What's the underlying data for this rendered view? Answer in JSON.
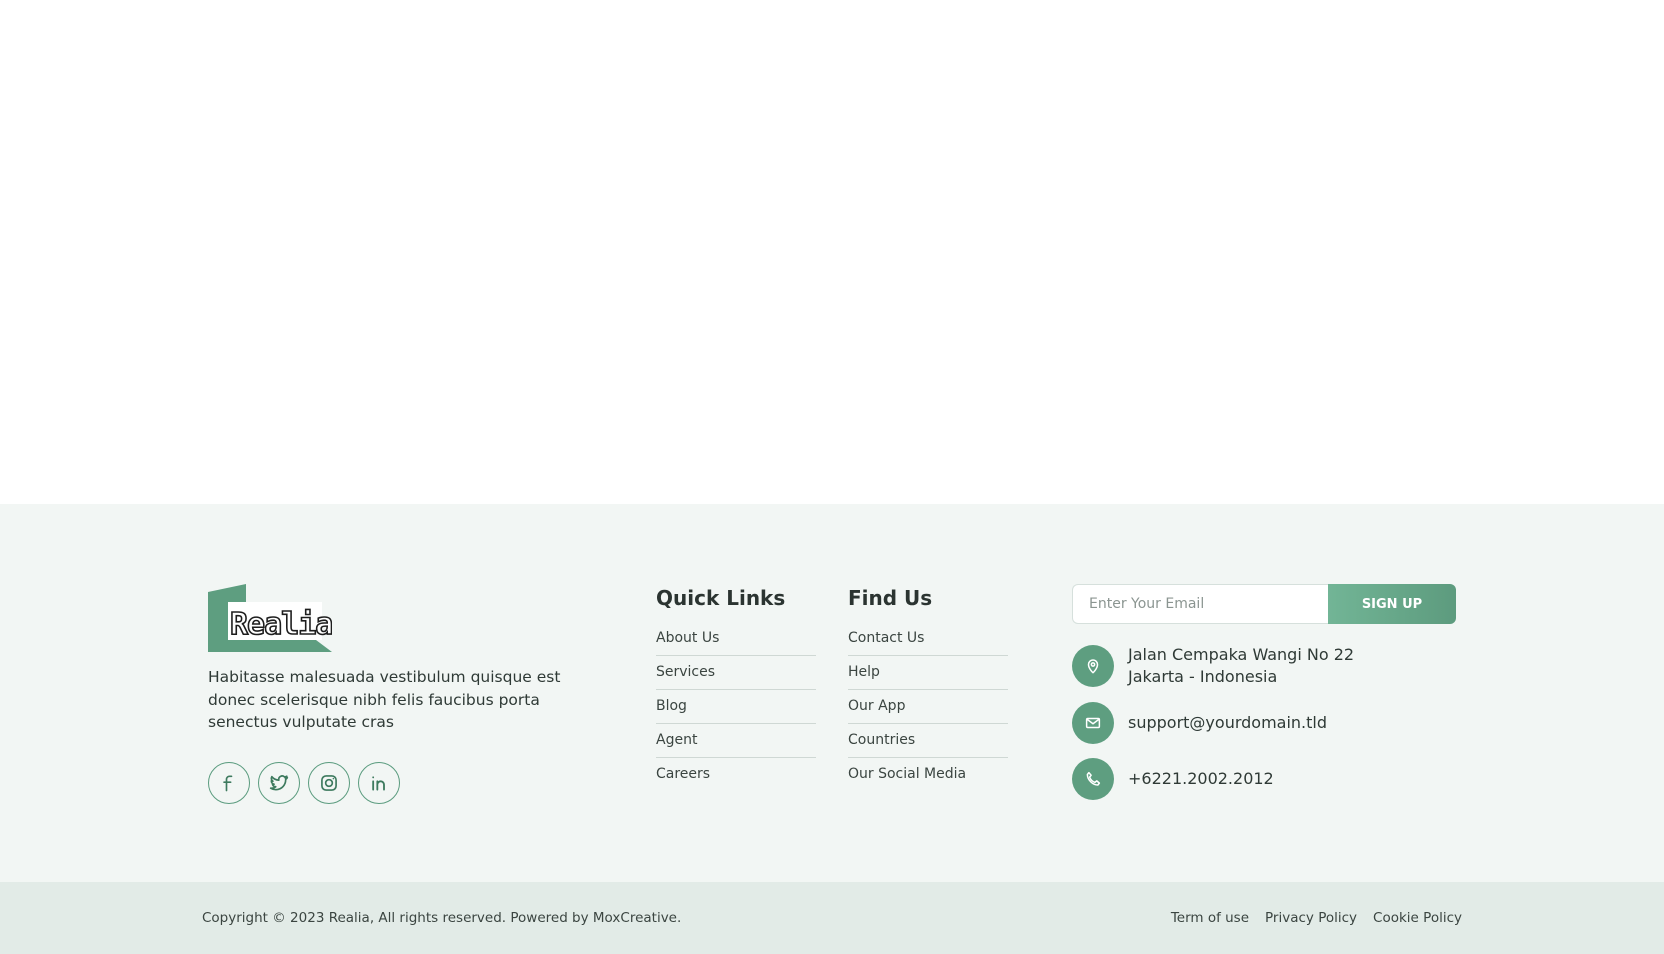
{
  "brand": {
    "logo_text": "Realia",
    "about": "Habitasse malesuada vestibulum quisque est donec scelerisque nibh felis faucibus porta senectus vulputate cras",
    "socials": [
      {
        "icon": "facebook-icon"
      },
      {
        "icon": "twitter-icon"
      },
      {
        "icon": "instagram-icon"
      },
      {
        "icon": "linkedin-icon"
      }
    ]
  },
  "quick_links": {
    "title": "Quick Links",
    "items": [
      "About Us",
      "Services",
      "Blog",
      "Agent",
      "Careers"
    ]
  },
  "find_us": {
    "title": "Find Us",
    "items": [
      "Contact Us",
      "Help",
      "Our App",
      "Countries",
      "Our Social Media"
    ]
  },
  "newsletter": {
    "placeholder": "Enter Your Email",
    "button_label": "SIGN UP"
  },
  "contact": {
    "address_line1": "Jalan Cempaka Wangi No 22",
    "address_line2": "Jakarta - Indonesia",
    "email": "support@yourdomain.tld",
    "phone": "+6221.2002.2012"
  },
  "bottom": {
    "copyright": "Copyright © 2023 Realia, All rights reserved. Powered by MoxCreative.",
    "links": [
      "Term of use",
      "Privacy Policy",
      "Cookie Policy"
    ]
  },
  "colors": {
    "accent": "#5e9e80",
    "footer_bg": "#f2f6f4",
    "bottom_bg": "#e2ebe7"
  }
}
